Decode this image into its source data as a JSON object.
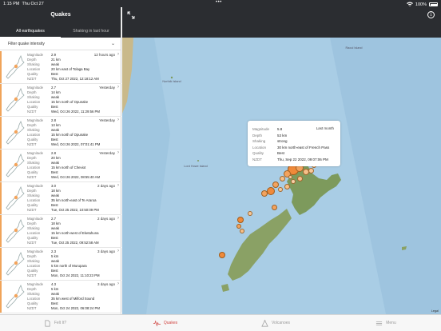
{
  "status": {
    "time": "1:15 PM",
    "date": "Thu Oct 27",
    "battery": "100%"
  },
  "left": {
    "title": "Quakes",
    "tabs": [
      "All earthquakes",
      "Shaking in last hour"
    ],
    "filter_label": "Filter quake intensity",
    "field_labels": [
      "Magnitude",
      "Depth",
      "Shaking",
      "Location",
      "Quality",
      "NZDT"
    ],
    "quakes": [
      {
        "magnitude": "2.9",
        "depth": "21 km",
        "shaking": "weak",
        "location": "20 km east of Tolaga Bay",
        "quality": "Best",
        "nzdt": "Thu, Oct 27 2022, 12:18:12 AM",
        "when": "12 hours ago"
      },
      {
        "magnitude": "2.7",
        "depth": "14 km",
        "shaking": "weak",
        "location": "15 km north of Opunake",
        "quality": "Best",
        "nzdt": "Wed, Oct 26 2022, 11:29:56 PM",
        "when": "Yesterday"
      },
      {
        "magnitude": "2.8",
        "depth": "13 km",
        "shaking": "weak",
        "location": "15 km north of Opunake",
        "quality": "Best",
        "nzdt": "Wed, Oct 26 2022, 07:01:41 PM",
        "when": "Yesterday"
      },
      {
        "magnitude": "2.8",
        "depth": "20 km",
        "shaking": "weak",
        "location": "15 km north of Cheviot",
        "quality": "Best",
        "nzdt": "Wed, Oct 26 2022, 08:55:40 AM",
        "when": "Yesterday"
      },
      {
        "magnitude": "3.0",
        "depth": "18 km",
        "shaking": "weak",
        "location": "35 km north-east of Te Araroa",
        "quality": "Best",
        "nzdt": "Tue, Oct 25 2022, 10:50:09 PM",
        "when": "2 days ago"
      },
      {
        "magnitude": "2.7",
        "depth": "18 km",
        "shaking": "weak",
        "location": "15 km north-west of Eketahuna",
        "quality": "Best",
        "nzdt": "Tue, Oct 25 2022, 09:52:58 AM",
        "when": "2 days ago"
      },
      {
        "magnitude": "2.3",
        "depth": "5 km",
        "shaking": "weak",
        "location": "5 km north of Murupara",
        "quality": "Best",
        "nzdt": "Mon, Oct 24 2022, 11:10:23 PM",
        "when": "3 days ago"
      },
      {
        "magnitude": "4.3",
        "depth": "5 km",
        "shaking": "weak",
        "location": "35 km west of Milford Sound",
        "quality": "Best",
        "nzdt": "Mon, Oct 24 2022, 06:08:24 PM",
        "when": "3 days ago"
      }
    ]
  },
  "map": {
    "places": [
      "Norfolk Island",
      "Lord Howe Island",
      "Raoul Island"
    ],
    "attribution": "Legal",
    "popup": {
      "magnitude": "5.8",
      "depth": "53 km",
      "shaking": "strong",
      "location": "30 km north-east of French Pass",
      "quality": "Best",
      "nzdt": "Thu, Sep 22 2022, 09:07:06 PM",
      "when": "Last month"
    }
  },
  "tabbar": [
    {
      "label": "Felt It?",
      "icon": "felt-it-icon"
    },
    {
      "label": "Quakes",
      "icon": "quakes-icon",
      "active": true
    },
    {
      "label": "Volcanoes",
      "icon": "volcano-icon"
    },
    {
      "label": "Menu",
      "icon": "menu-icon"
    }
  ]
}
